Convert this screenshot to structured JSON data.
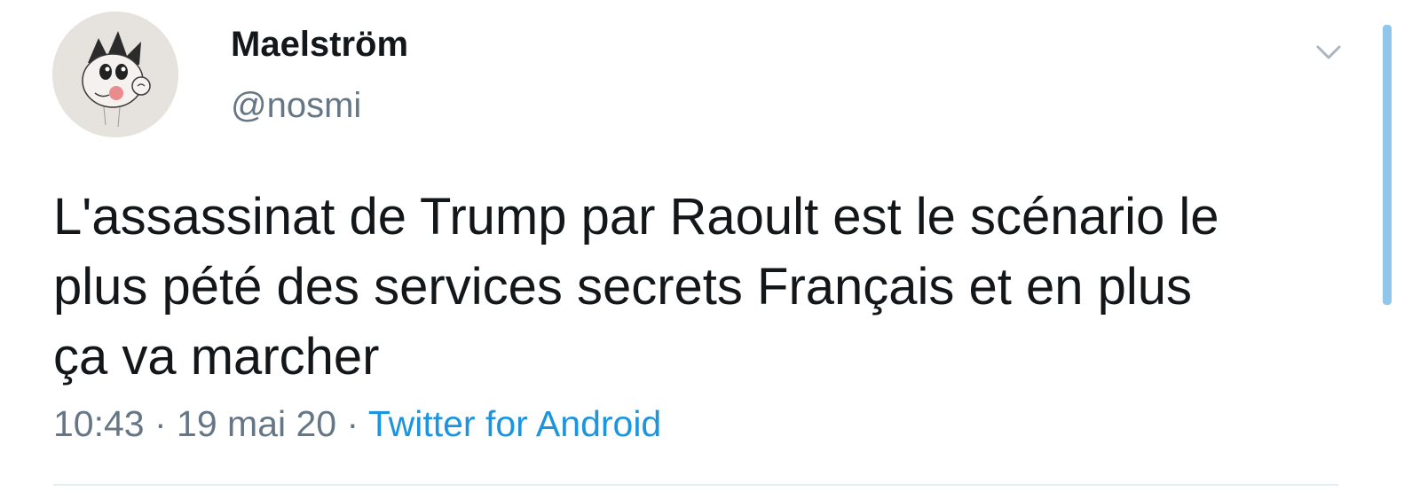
{
  "tweet": {
    "display_name": "Maelström",
    "handle": "@nosmi",
    "text_lines": [
      "L'assassinat de Trump par Raoult est le scénario le",
      "plus pété des services secrets Français et en plus",
      "ça va marcher"
    ],
    "time": "10:43",
    "date": "19 mai 20",
    "separator": " · ",
    "source": "Twitter for Android"
  },
  "icons": {
    "menu": "chevron-down-icon"
  },
  "colors": {
    "text": "#14171a",
    "secondary": "#657786",
    "link": "#1b95e0",
    "divider": "#e6ecf0",
    "scrollbar": "#8fc6ea"
  }
}
